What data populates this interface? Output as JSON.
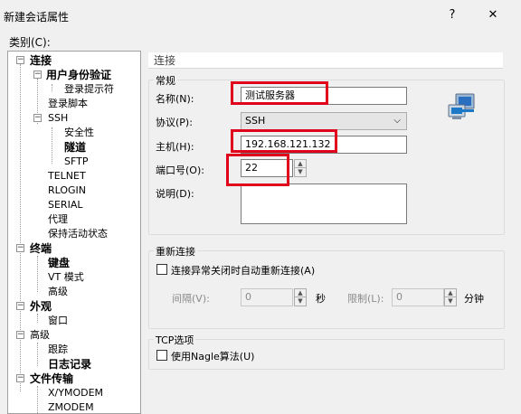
{
  "window": {
    "title": "新建会话属性",
    "help": "?",
    "close": "✕"
  },
  "category_label": "类别(C):",
  "tree": {
    "connection": "连接",
    "auth": "用户身份验证",
    "login_prompt": "登录提示符",
    "login_script": "登录脚本",
    "ssh": "SSH",
    "security": "安全性",
    "tunnel": "隧道",
    "sftp": "SFTP",
    "telnet": "TELNET",
    "rlogin": "RLOGIN",
    "serial": "SERIAL",
    "proxy": "代理",
    "keepalive": "保持活动状态",
    "terminal": "终端",
    "keyboard": "键盘",
    "vt_mode": "VT 模式",
    "advanced": "高级",
    "appearance": "外观",
    "window": "窗口",
    "advanced2": "高级",
    "trace": "跟踪",
    "log": "日志记录",
    "file_transfer": "文件传输",
    "xymodem": "X/YMODEM",
    "zmodem": "ZMODEM"
  },
  "panel": {
    "header": "连接",
    "general": {
      "title": "常规",
      "name_label": "名称(N):",
      "name_value": "测试服务器",
      "protocol_label": "协议(P):",
      "protocol_value": "SSH",
      "host_label": "主机(H):",
      "host_value": "192.168.121.132",
      "port_label": "端口号(O):",
      "port_value": "22",
      "desc_label": "说明(D):",
      "desc_value": ""
    },
    "reconnect": {
      "title": "重新连接",
      "auto_label": "连接异常关闭时自动重新连接(A)",
      "interval_label": "间隔(V):",
      "interval_value": "0",
      "seconds": "秒",
      "limit_label": "限制(L):",
      "limit_value": "0",
      "minutes": "分钟"
    },
    "tcp": {
      "title": "TCP选项",
      "nagle_label": "使用Nagle算法(U)"
    }
  },
  "colors": {
    "highlight_box": "#e0001b",
    "accent_icon": "#1e78c8"
  }
}
